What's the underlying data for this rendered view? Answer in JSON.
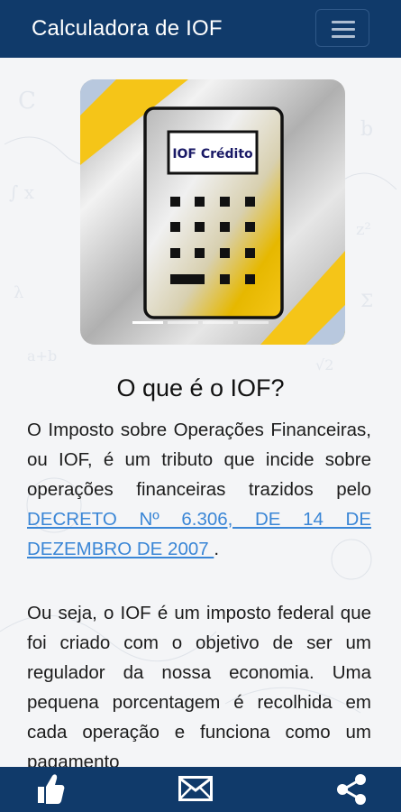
{
  "app": {
    "title": "Calculadora de IOF"
  },
  "carousel": {
    "slide_label": "IOF Crédito",
    "slide_count": 4,
    "active_slide": 1
  },
  "content": {
    "heading": "O que é o IOF?",
    "paragraph1_text": "O Imposto sobre Operações Financeiras, ou IOF, é um tributo que incide sobre operações financeiras trazidos pelo ",
    "paragraph1_link": "DECRETO Nº 6.306, DE 14 DE DEZEMBRO DE 2007 ",
    "paragraph1_end": ".",
    "paragraph2": "Ou seja, o IOF é um imposto federal que foi criado com o objetivo de ser um regulador da nossa economia. Uma pequena porcentagem é recolhida em cada operação e funciona como um pagamento"
  },
  "bottom_bar": {
    "icons": [
      "thumbs-up-icon",
      "mail-icon",
      "share-icon"
    ]
  },
  "colors": {
    "primary": "#103a6a",
    "link": "#3a86d6",
    "gold": "#f5c518"
  }
}
